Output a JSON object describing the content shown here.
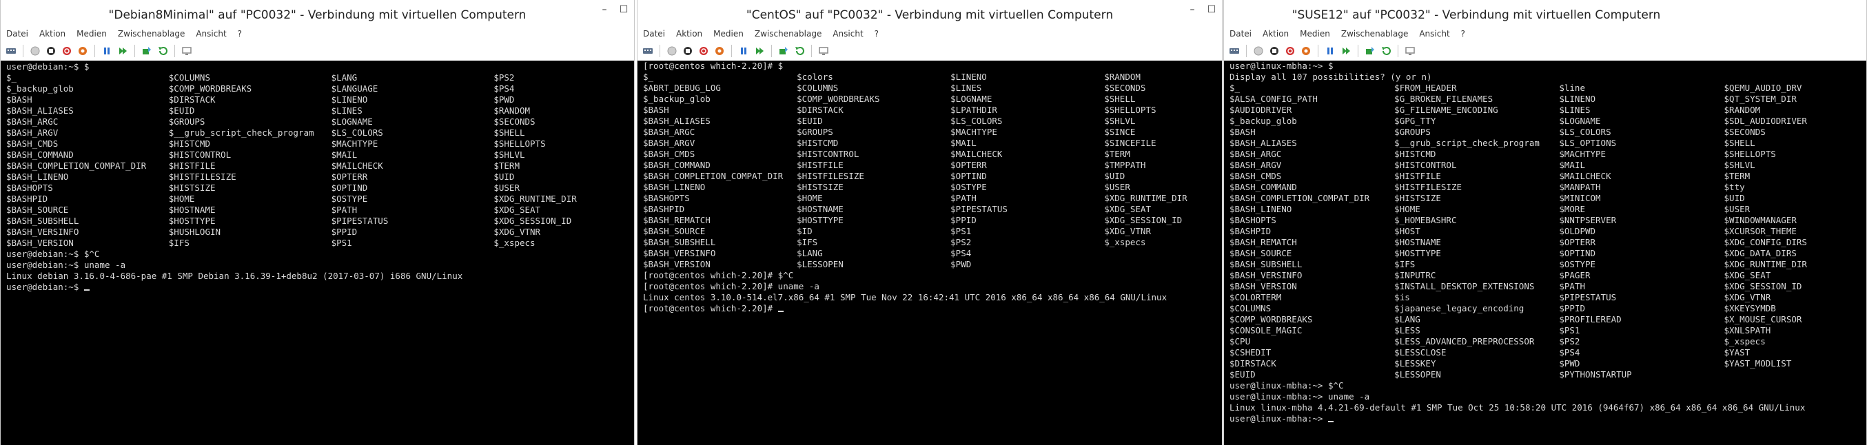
{
  "menu": [
    "Datei",
    "Aktion",
    "Medien",
    "Zwischenablage",
    "Ansicht",
    "?"
  ],
  "window_controls": {
    "minimize": "–",
    "maximize": "☐"
  },
  "colors": {
    "terminal_bg": "#000000",
    "terminal_fg": "#d9d9d9",
    "toolbar_green": "#2e9b3a",
    "toolbar_blue": "#2b6fcf",
    "toolbar_red": "#d23030"
  },
  "windows": [
    {
      "title": "\"Debian8Minimal\" auf \"PC0032\" - Verbindung mit virtuellen Computern",
      "before": [
        "user@debian:~$ $"
      ],
      "table": [
        [
          "$_",
          "$COLUMNS",
          "$LANG",
          "$PS2"
        ],
        [
          "$_backup_glob",
          "$COMP_WORDBREAKS",
          "$LANGUAGE",
          "$PS4"
        ],
        [
          "$BASH",
          "$DIRSTACK",
          "$LINENO",
          "$PWD"
        ],
        [
          "$BASH_ALIASES",
          "$EUID",
          "$LINES",
          "$RANDOM"
        ],
        [
          "$BASH_ARGC",
          "$GROUPS",
          "$LOGNAME",
          "$SECONDS"
        ],
        [
          "$BASH_ARGV",
          "$__grub_script_check_program",
          "$LS_COLORS",
          "$SHELL"
        ],
        [
          "$BASH_CMDS",
          "$HISTCMD",
          "$MACHTYPE",
          "$SHELLOPTS"
        ],
        [
          "$BASH_COMMAND",
          "$HISTCONTROL",
          "$MAIL",
          "$SHLVL"
        ],
        [
          "$BASH_COMPLETION_COMPAT_DIR",
          "$HISTFILE",
          "$MAILCHECK",
          "$TERM"
        ],
        [
          "$BASH_LINENO",
          "$HISTFILESIZE",
          "$OPTERR",
          "$UID"
        ],
        [
          "$BASHOPTS",
          "$HISTSIZE",
          "$OPTIND",
          "$USER"
        ],
        [
          "$BASHPID",
          "$HOME",
          "$OSTYPE",
          "$XDG_RUNTIME_DIR"
        ],
        [
          "$BASH_SOURCE",
          "$HOSTNAME",
          "$PATH",
          "$XDG_SEAT"
        ],
        [
          "$BASH_SUBSHELL",
          "$HOSTTYPE",
          "$PIPESTATUS",
          "$XDG_SESSION_ID"
        ],
        [
          "$BASH_VERSINFO",
          "$HUSHLOGIN",
          "$PPID",
          "$XDG_VTNR"
        ],
        [
          "$BASH_VERSION",
          "$IFS",
          "$PS1",
          "$_xspecs"
        ]
      ],
      "after": [
        "user@debian:~$ $^C",
        "user@debian:~$ uname -a",
        "Linux debian 3.16.0-4-686-pae #1 SMP Debian 3.16.39-1+deb8u2 (2017-03-07) i686 GNU/Linux",
        "user@debian:~$ "
      ]
    },
    {
      "title": "\"CentOS\" auf \"PC0032\" - Verbindung mit virtuellen Computern",
      "before": [
        "[root@centos which-2.20]# $"
      ],
      "table": [
        [
          "$_",
          "$colors",
          "$LINENO",
          "$RANDOM"
        ],
        [
          "$ABRT_DEBUG_LOG",
          "$COLUMNS",
          "$LINES",
          "$SECONDS"
        ],
        [
          "$_backup_glob",
          "$COMP_WORDBREAKS",
          "$LOGNAME",
          "$SHELL"
        ],
        [
          "$BASH",
          "$DIRSTACK",
          "$LPATHDIR",
          "$SHELLOPTS"
        ],
        [
          "$BASH_ALIASES",
          "$EUID",
          "$LS_COLORS",
          "$SHLVL"
        ],
        [
          "$BASH_ARGC",
          "$GROUPS",
          "$MACHTYPE",
          "$SINCE"
        ],
        [
          "$BASH_ARGV",
          "$HISTCMD",
          "$MAIL",
          "$SINCEFILE"
        ],
        [
          "$BASH_CMDS",
          "$HISTCONTROL",
          "$MAILCHECK",
          "$TERM"
        ],
        [
          "$BASH_COMMAND",
          "$HISTFILE",
          "$OPTERR",
          "$TMPPATH"
        ],
        [
          "$BASH_COMPLETION_COMPAT_DIR",
          "$HISTFILESIZE",
          "$OPTIND",
          "$UID"
        ],
        [
          "$BASH_LINENO",
          "$HISTSIZE",
          "$OSTYPE",
          "$USER"
        ],
        [
          "$BASHOPTS",
          "$HOME",
          "$PATH",
          "$XDG_RUNTIME_DIR"
        ],
        [
          "$BASHPID",
          "$HOSTNAME",
          "$PIPESTATUS",
          "$XDG_SEAT"
        ],
        [
          "$BASH_REMATCH",
          "$HOSTTYPE",
          "$PPID",
          "$XDG_SESSION_ID"
        ],
        [
          "$BASH_SOURCE",
          "$ID",
          "$PS1",
          "$XDG_VTNR"
        ],
        [
          "$BASH_SUBSHELL",
          "$IFS",
          "$PS2",
          "$_xspecs"
        ],
        [
          "$BASH_VERSINFO",
          "$LANG",
          "$PS4",
          ""
        ],
        [
          "$BASH_VERSION",
          "$LESSOPEN",
          "$PWD",
          ""
        ]
      ],
      "after": [
        "[root@centos which-2.20]# $^C",
        "[root@centos which-2.20]# uname -a",
        "Linux centos 3.10.0-514.el7.x86_64 #1 SMP Tue Nov 22 16:42:41 UTC 2016 x86_64 x86_64 x86_64 GNU/Linux",
        "[root@centos which-2.20]# "
      ]
    },
    {
      "title": "\"SUSE12\" auf \"PC0032\" - Verbindung mit virtuellen Computern",
      "before": [
        "user@linux-mbha:~> $",
        "Display all 107 possibilities? (y or n)"
      ],
      "table": [
        [
          "$_",
          "$FROM_HEADER",
          "$line",
          "$QEMU_AUDIO_DRV"
        ],
        [
          "$ALSA_CONFIG_PATH",
          "$G_BROKEN_FILENAMES",
          "$LINENO",
          "$QT_SYSTEM_DIR"
        ],
        [
          "$AUDIODRIVER",
          "$G_FILENAME_ENCODING",
          "$LINES",
          "$RANDOM"
        ],
        [
          "$_backup_glob",
          "$GPG_TTY",
          "$LOGNAME",
          "$SDL_AUDIODRIVER"
        ],
        [
          "$BASH",
          "$GROUPS",
          "$LS_COLORS",
          "$SECONDS"
        ],
        [
          "$BASH_ALIASES",
          "$__grub_script_check_program",
          "$LS_OPTIONS",
          "$SHELL"
        ],
        [
          "$BASH_ARGC",
          "$HISTCMD",
          "$MACHTYPE",
          "$SHELLOPTS"
        ],
        [
          "$BASH_ARGV",
          "$HISTCONTROL",
          "$MAIL",
          "$SHLVL"
        ],
        [
          "$BASH_CMDS",
          "$HISTFILE",
          "$MAILCHECK",
          "$TERM"
        ],
        [
          "$BASH_COMMAND",
          "$HISTFILESIZE",
          "$MANPATH",
          "$tty"
        ],
        [
          "$BASH_COMPLETION_COMPAT_DIR",
          "$HISTSIZE",
          "$MINICOM",
          "$UID"
        ],
        [
          "$BASH_LINENO",
          "$HOME",
          "$MORE",
          "$USER"
        ],
        [
          "$BASHOPTS",
          "$_HOMEBASHRC",
          "$NNTPSERVER",
          "$WINDOWMANAGER"
        ],
        [
          "$BASHPID",
          "$HOST",
          "$OLDPWD",
          "$XCURSOR_THEME"
        ],
        [
          "$BASH_REMATCH",
          "$HOSTNAME",
          "$OPTERR",
          "$XDG_CONFIG_DIRS"
        ],
        [
          "$BASH_SOURCE",
          "$HOSTTYPE",
          "$OPTIND",
          "$XDG_DATA_DIRS"
        ],
        [
          "$BASH_SUBSHELL",
          "$IFS",
          "$OSTYPE",
          "$XDG_RUNTIME_DIR"
        ],
        [
          "$BASH_VERSINFO",
          "$INPUTRC",
          "$PAGER",
          "$XDG_SEAT"
        ],
        [
          "$BASH_VERSION",
          "$INSTALL_DESKTOP_EXTENSIONS",
          "$PATH",
          "$XDG_SESSION_ID"
        ],
        [
          "$COLORTERM",
          "$is",
          "$PIPESTATUS",
          "$XDG_VTNR"
        ],
        [
          "$COLUMNS",
          "$japanese_legacy_encoding",
          "$PPID",
          "$XKEYSYMDB"
        ],
        [
          "$COMP_WORDBREAKS",
          "$LANG",
          "$PROFILEREAD",
          "$X_MOUSE_CURSOR"
        ],
        [
          "$CONSOLE_MAGIC",
          "$LESS",
          "$PS1",
          "$XNLSPATH"
        ],
        [
          "$CPU",
          "$LESS_ADVANCED_PREPROCESSOR",
          "$PS2",
          "$_xspecs"
        ],
        [
          "$CSHEDIT",
          "$LESSCLOSE",
          "$PS4",
          "$YAST"
        ],
        [
          "$DIRSTACK",
          "$LESSKEY",
          "$PWD",
          "$YAST_MODLIST"
        ],
        [
          "$EUID",
          "$LESSOPEN",
          "$PYTHONSTARTUP",
          ""
        ]
      ],
      "after": [
        "user@linux-mbha:~> $^C",
        "user@linux-mbha:~> uname -a",
        "Linux linux-mbha 4.4.21-69-default #1 SMP Tue Oct 25 10:58:20 UTC 2016 (9464f67) x86_64 x86_64 x86_64 GNU/Linux",
        "user@linux-mbha:~> "
      ]
    }
  ]
}
